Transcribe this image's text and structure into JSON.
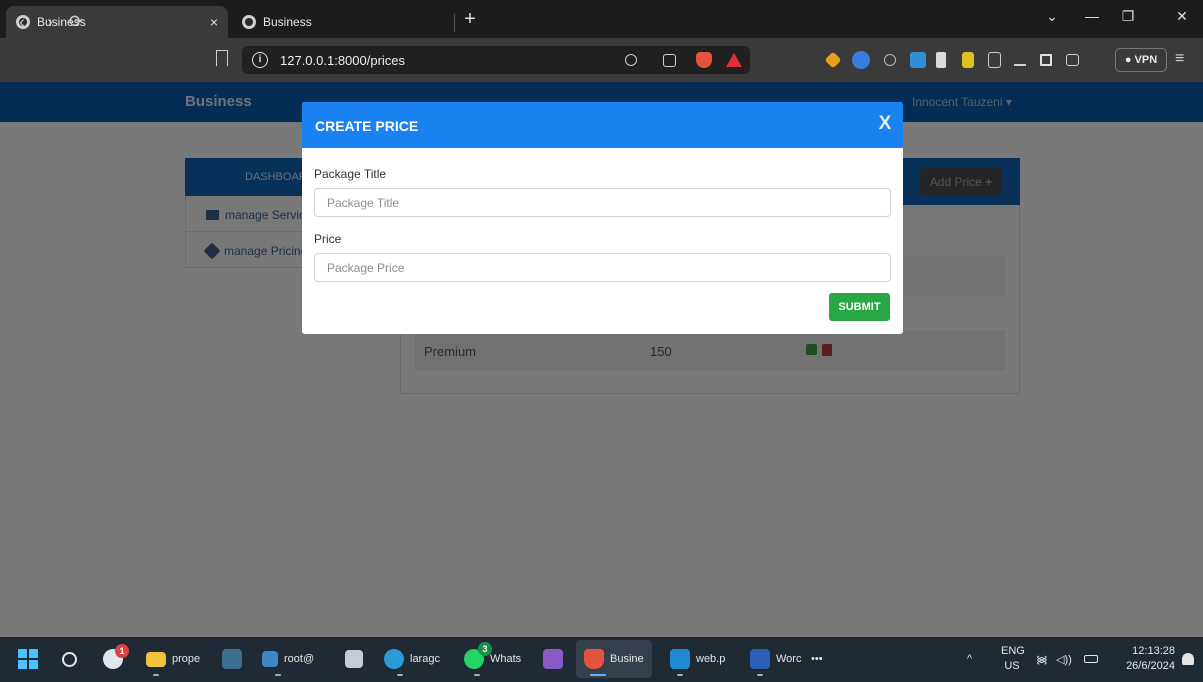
{
  "browser": {
    "tabs": [
      {
        "label": "Business",
        "close": "×"
      },
      {
        "label": "Business"
      }
    ],
    "new_tab": "+",
    "url": "127.0.0.1:8000/prices",
    "vpn_label": "VPN",
    "window_controls": {
      "dropdown": "⌄",
      "minimize": "—",
      "restore": "❐",
      "close": "✕"
    },
    "nav": {
      "back": "‹",
      "forward": "›",
      "reload": "⟳"
    },
    "menu": "≡"
  },
  "app": {
    "brand": "Business",
    "user": "Innocent Tauzeni",
    "user_caret": "▾",
    "sidebar": {
      "header": "DASHBOARD",
      "items": [
        {
          "label": "manage Services",
          "icon": "folder-icon"
        },
        {
          "label": "manage Pricing",
          "icon": "tag-icon"
        }
      ]
    },
    "content": {
      "add_button": "Add Price",
      "add_icon": "+",
      "rows": [
        {
          "title": "Premium",
          "price": "150"
        }
      ]
    }
  },
  "modal": {
    "title": "CREATE PRICE",
    "close": "X",
    "fields": [
      {
        "label": "Package Title",
        "placeholder": "Package Title",
        "value": ""
      },
      {
        "label": "Price",
        "placeholder": "Package Price",
        "value": ""
      }
    ],
    "submit": "SUBMIT"
  },
  "taskbar": {
    "items": [
      {
        "label": "prope"
      },
      {
        "label": "root@"
      },
      {
        "label": "laragc"
      },
      {
        "label": "Whats",
        "badge": "3"
      },
      {
        "label": "Busine"
      },
      {
        "label": "web.p"
      },
      {
        "label": "Worc"
      }
    ],
    "weather_badge": "1",
    "more": "•••",
    "tray_chevron": "^",
    "lang_top": "ENG",
    "lang_bottom": "US",
    "time": "12:13:28",
    "date": "26/6/2024"
  },
  "colors": {
    "modal_header": "#1a82f0",
    "submit": "#28a745",
    "nav": "#0a5ba8"
  }
}
